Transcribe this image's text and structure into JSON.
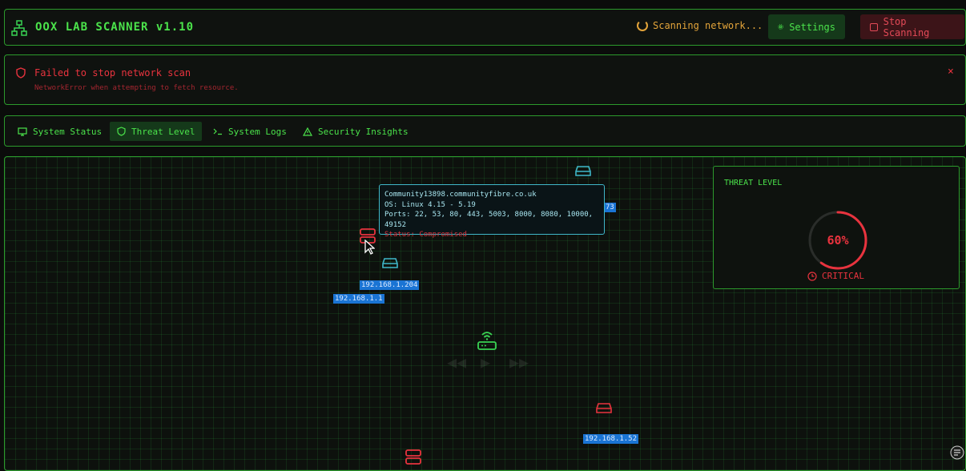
{
  "header": {
    "title": "OOX LAB SCANNER v1.10",
    "scan_status": "Scanning network...",
    "settings_label": "Settings",
    "stop_label": "Stop Scanning"
  },
  "error": {
    "title": "Failed to stop network scan",
    "message": "NetworkError when attempting to fetch resource.",
    "close": "×"
  },
  "tabs": [
    {
      "label": "System Status",
      "icon": "monitor-icon",
      "active": false
    },
    {
      "label": "Threat Level",
      "icon": "shield-icon",
      "active": true
    },
    {
      "label": "System Logs",
      "icon": "terminal-icon",
      "active": false
    },
    {
      "label": "Security Insights",
      "icon": "warning-icon",
      "active": false
    }
  ],
  "map": {
    "ip_labels": [
      "192.168.1.204",
      "192.168.1.1",
      "192.168.1.52",
      "73"
    ],
    "tooltip": {
      "host": "Community13898.communityfibre.co.uk",
      "os": "OS: Linux 4.15 - 5.19",
      "ports": "Ports: 22, 53, 80, 443, 5003, 8000, 8080, 10000, 49152",
      "status": "Status: Compromised"
    }
  },
  "threat": {
    "title": "THREAT LEVEL",
    "value": 60,
    "value_text": "60%",
    "level": "CRITICAL"
  },
  "colors": {
    "accent_green": "#39d353",
    "danger_red": "#e8333e",
    "warning_orange": "#e3a43a",
    "info_cyan": "#3fb7c9",
    "ip_blue": "#1a74d4"
  }
}
